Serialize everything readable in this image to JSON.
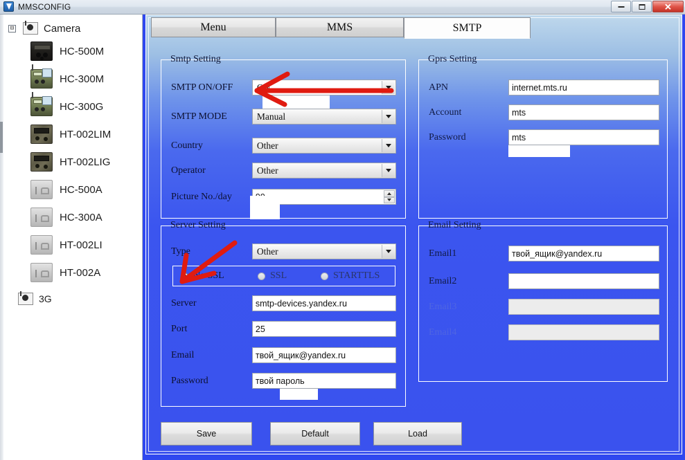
{
  "window": {
    "title": "MMSCONFIG",
    "icon": "app-logo-icon",
    "controls": {
      "minimize": "–",
      "maximize": "□",
      "close": "✕"
    }
  },
  "sidebar": {
    "root": {
      "label": "Camera",
      "expander": "⊟",
      "icon": "camera-folder-icon"
    },
    "items": [
      {
        "label": "HC-500M",
        "icon": "camera-dark-icon"
      },
      {
        "label": "HC-300M",
        "icon": "camera-green-icon"
      },
      {
        "label": "HC-300G",
        "icon": "camera-green-icon"
      },
      {
        "label": "HT-002LIM",
        "icon": "camera-camo-icon"
      },
      {
        "label": "HT-002LIG",
        "icon": "camera-camo-icon"
      },
      {
        "label": "HC-500A",
        "icon": "camera-grey-icon"
      },
      {
        "label": "HC-300A",
        "icon": "camera-grey-icon"
      },
      {
        "label": "HT-002LI",
        "icon": "camera-grey-icon"
      },
      {
        "label": "HT-002A",
        "icon": "camera-grey-icon"
      }
    ],
    "footer": {
      "label": "3G",
      "icon": "camera-folder-icon"
    }
  },
  "tabs": [
    {
      "label": "Menu",
      "active": false
    },
    {
      "label": "MMS",
      "active": false
    },
    {
      "label": "SMTP",
      "active": true
    }
  ],
  "smtp_setting": {
    "title": "Smtp Setting",
    "fields": {
      "smtp_onoff": {
        "label": "SMTP ON/OFF",
        "value": "ON"
      },
      "smtp_mode": {
        "label": "SMTP MODE",
        "value": "Manual"
      },
      "country": {
        "label": "Country",
        "value": "Other"
      },
      "operator": {
        "label": "Operator",
        "value": "Other"
      },
      "picture_no": {
        "label": "Picture No./day",
        "value": "99"
      }
    }
  },
  "gprs_setting": {
    "title": "Gprs Setting",
    "fields": {
      "apn": {
        "label": "APN",
        "value": "internet.mts.ru"
      },
      "account": {
        "label": "Account",
        "value": "mts"
      },
      "password": {
        "label": "Password",
        "value": "mts"
      }
    }
  },
  "server_setting": {
    "title": "Server Setting",
    "fields": {
      "type": {
        "label": "Type",
        "value": "Other"
      },
      "server": {
        "label": "Server",
        "value": "smtp-devices.yandex.ru"
      },
      "port": {
        "label": "Port",
        "value": "25"
      },
      "email": {
        "label": "Email",
        "value": "твой_ящик@yandex.ru"
      },
      "password": {
        "label": "Password",
        "value": "твой пароль"
      }
    },
    "ssl_options": [
      {
        "label": "No SSL",
        "selected": true
      },
      {
        "label": "SSL",
        "selected": false
      },
      {
        "label": "STARTTLS",
        "selected": false
      }
    ]
  },
  "email_setting": {
    "title": "Email Setting",
    "fields": [
      {
        "label": "Email1",
        "value": "твой_ящик@yandex.ru",
        "disabled": false
      },
      {
        "label": "Email2",
        "value": "",
        "disabled": false
      },
      {
        "label": "Email3",
        "value": "",
        "disabled": true
      },
      {
        "label": "Email4",
        "value": "",
        "disabled": true
      }
    ]
  },
  "buttons": {
    "save": "Save",
    "default": "Default",
    "load": "Load"
  },
  "annotations": {
    "arrow_smtp_onoff": "red-arrow-pointing-to-smtp-onoff",
    "arrow_no_ssl": "red-arrow-pointing-to-no-ssl"
  },
  "colors": {
    "panel_blue": "#3a52ee",
    "panel_top_blue": "#bfd8ec",
    "annotation_red": "#e01b10",
    "title_bar": "#dfe7f0"
  }
}
